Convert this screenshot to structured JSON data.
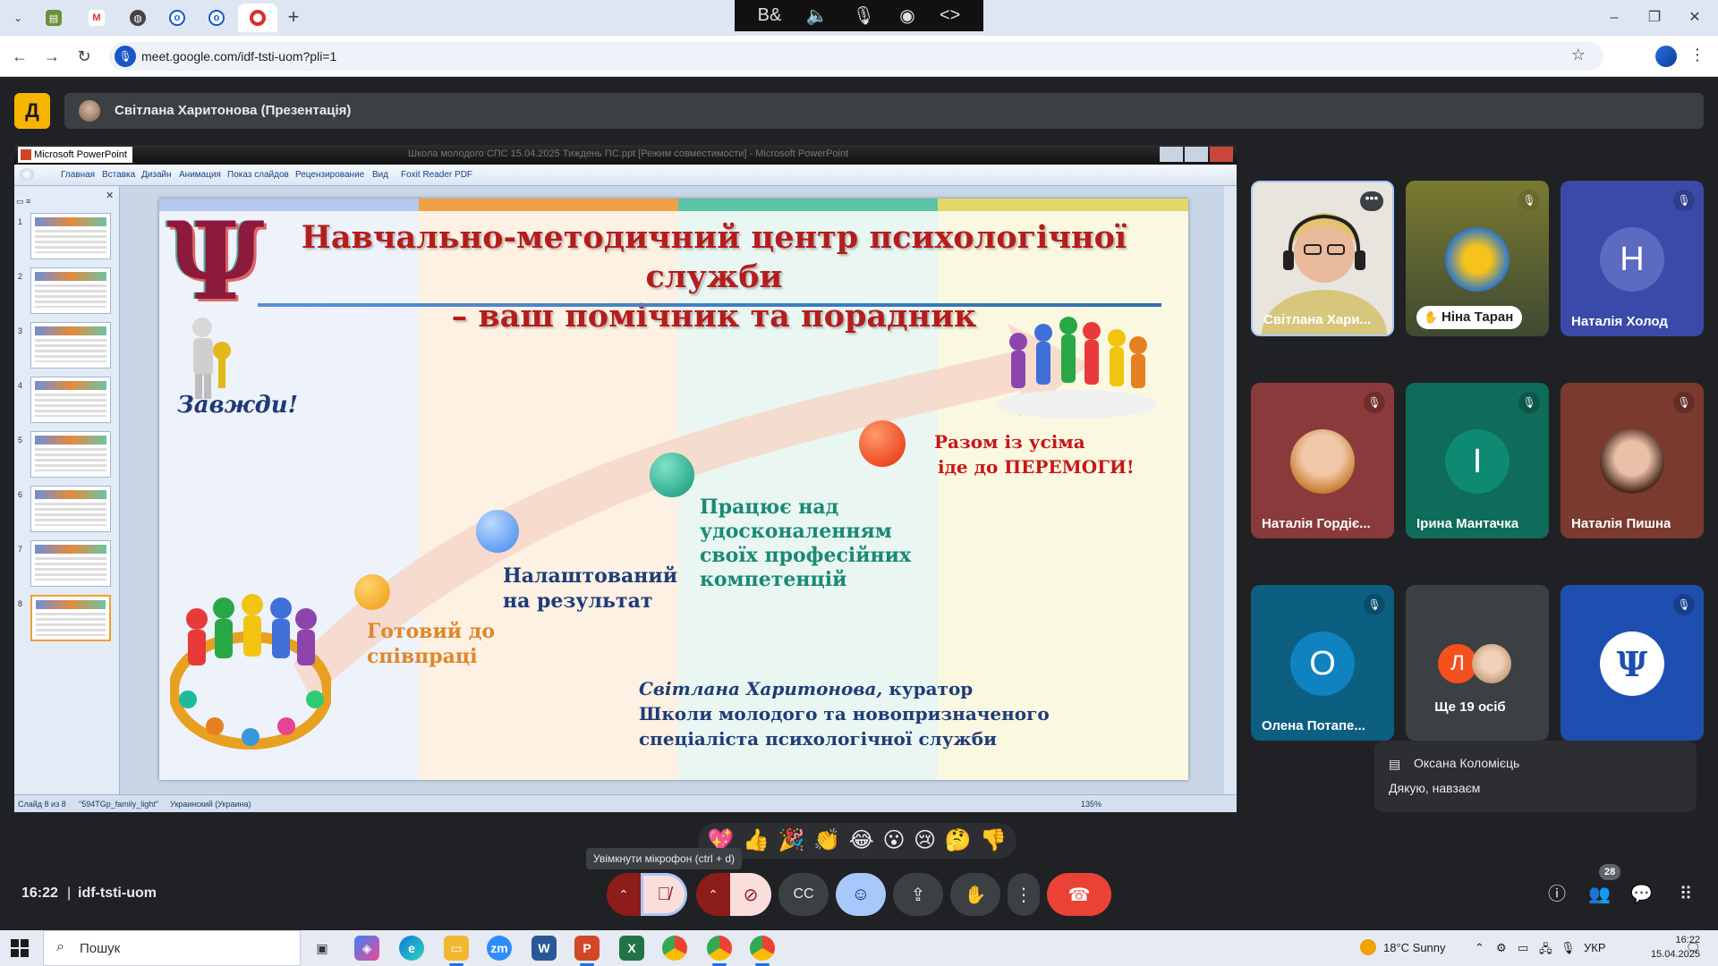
{
  "browser": {
    "url": "meet.google.com/idf-tsti-uom?pli=1",
    "colors": {
      "tabbar": "#dfe6f3",
      "omnibox": "#eef2f9"
    }
  },
  "media_overlay": {
    "icons": [
      "bd-icon",
      "speaker-mute-icon",
      "mic-icon",
      "broadcast-icon",
      "code-icon"
    ]
  },
  "meet": {
    "presenter_title": "Світлана Харитонова (Презентація)",
    "clock": "16:22",
    "separator": "|",
    "meeting_code": "idf-tsti-uom",
    "tooltip": "Увімкнути мікрофон (ctrl + d)",
    "participants_count": "28",
    "reactions": [
      "💖",
      "👍",
      "🎉",
      "👏",
      "😂",
      "😮",
      "😢",
      "🤔",
      "👎"
    ],
    "chat_toast": {
      "sender": "Оксана Коломієць",
      "message": "Дякую, навзаєм"
    },
    "colors": {
      "end_call": "#ea4335",
      "muted": "#f9dedc",
      "reactions_active": "#a8c7fa"
    }
  },
  "participants": [
    {
      "name": "Світлана Хари...",
      "type": "video"
    },
    {
      "name": "Ніна Таран",
      "type": "photo",
      "hand_raised": true,
      "muted": true
    },
    {
      "name": "Наталія Холод",
      "initial": "Н",
      "muted": true
    },
    {
      "name": "Наталія Гордіє...",
      "type": "photo",
      "muted": true
    },
    {
      "name": "Ірина Мантачка",
      "initial": "І",
      "muted": true
    },
    {
      "name": "Наталія Пишна",
      "type": "photo",
      "muted": true
    },
    {
      "name": "Олена Потапе...",
      "initial": "О",
      "muted": true
    },
    {
      "name": "Ще 19 осіб",
      "initial": "Л"
    },
    {
      "name": "",
      "type": "logo",
      "muted": true
    }
  ],
  "ppt": {
    "app_name": "Microsoft PowerPoint",
    "doc_title": "Школа молодого СПС 15.04.2025 Тиждень ПС.ppt [Режим совместимости] - Microsoft PowerPoint",
    "menus": [
      "Главная",
      "Вставка",
      "Дизайн",
      "Анимация",
      "Показ слайдов",
      "Рецензирование",
      "Вид",
      "Foxit Reader PDF"
    ],
    "slide_count": 8,
    "selected_slide": 8,
    "status": {
      "slide": "Слайд 8 из 8",
      "theme": "\"594TGp_family_light\"",
      "lang": "Украинский (Украина)",
      "zoom": "135%"
    }
  },
  "slide": {
    "title_line1": "Навчально-методичний центр психологічної служби",
    "title_line2": "– ваш помічник та порадник",
    "always": "Завжди!",
    "step1_l1": "Готовий до",
    "step1_l2": "співпраці",
    "step2_l1": "Налаштований",
    "step2_l2": "на результат",
    "step3_l1": "Працює над",
    "step3_l2": "удосконаленням",
    "step3_l3": "своїх професійних",
    "step3_l4": "компетенцій",
    "step4_l1": "Разом із усіма",
    "step4_l2": "іде до ПЕРЕМОГИ!",
    "author_name": "Світлана Харитонова,",
    "author_role": " куратор",
    "author_l2": "Школи молодого та новопризначеного",
    "author_l3": "спеціаліста психологічної служби",
    "colors": {
      "title": "#b51d1d",
      "rule": "#2e6fb3"
    }
  },
  "taskbar": {
    "search_placeholder": "Пошук",
    "weather": "18°C  Sunny",
    "lang": "УКР",
    "time": "16:22",
    "date": "15.04.2025"
  }
}
